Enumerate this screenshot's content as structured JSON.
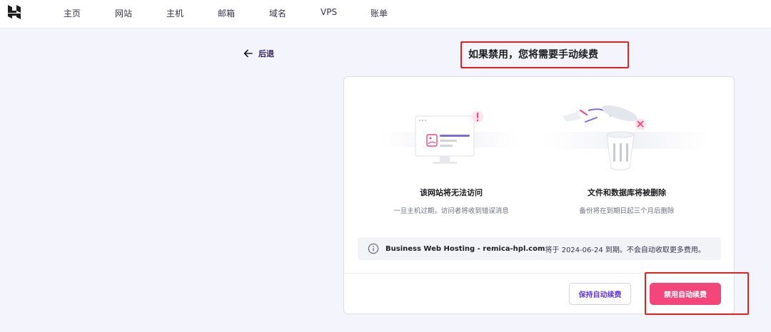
{
  "nav": {
    "logo_icon": "hostinger-logo-icon",
    "items": [
      {
        "label": "主页"
      },
      {
        "label": "网站"
      },
      {
        "label": "主机"
      },
      {
        "label": "邮箱"
      },
      {
        "label": "域名"
      },
      {
        "label": "VPS"
      },
      {
        "label": "账单"
      }
    ]
  },
  "back": {
    "label": "后退",
    "icon": "arrow-left-icon"
  },
  "title": "如果禁用，您将需要手动续费",
  "features": [
    {
      "icon": "website-unreachable-illustration",
      "title": "该网站将无法访问",
      "desc": "一旦主机过期，访问者将收到错误消息"
    },
    {
      "icon": "files-deleted-illustration",
      "title": "文件和数据库将被删除",
      "desc": "备份将在到期日起三个月后删除"
    }
  ],
  "notice": {
    "icon": "info-icon",
    "plan": "Business Web Hosting - remica-hpl.com",
    "text": " 将于 2024-06-24 到期。不会自动收取更多费用。"
  },
  "buttons": {
    "keep": "保持自动续费",
    "disable": "禁用自动续费"
  },
  "colors": {
    "primary": "#673de6",
    "danger": "#f5467c",
    "highlight": "#e8201d",
    "background": "#f4f4fc"
  }
}
